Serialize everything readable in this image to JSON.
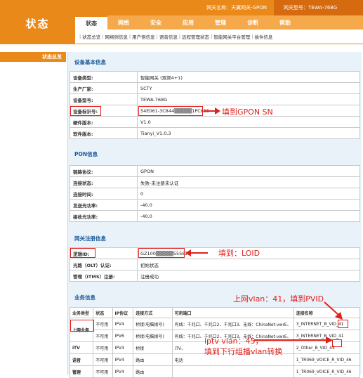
{
  "header": {
    "logo_text": "状态",
    "gateway_name": "网关名称：天翼网关-GPON",
    "gateway_model": "网关型号：TEWA-768G"
  },
  "tabs": [
    {
      "label": "状态",
      "active": true
    },
    {
      "label": "网络",
      "active": false
    },
    {
      "label": "安全",
      "active": false
    },
    {
      "label": "应用",
      "active": false
    },
    {
      "label": "管理",
      "active": false
    },
    {
      "label": "诊断",
      "active": false
    },
    {
      "label": "帮助",
      "active": false
    }
  ],
  "subnav": [
    "状态总览",
    "网络侧信息",
    "用户侧信息",
    "语音信息",
    "远程管理状态",
    "智能网关平台管理",
    "插件信息"
  ],
  "sidebar": {
    "item": "状态总览"
  },
  "device_info": {
    "title": "设备基本信息",
    "rows": [
      {
        "k": "设备类型:",
        "v": "智能网关 (双频4+1)"
      },
      {
        "k": "生产厂家:",
        "v": "SCTY"
      },
      {
        "k": "设备型号:",
        "v": "TEWA-768G"
      },
      {
        "k": "设备标识号:",
        "v": "54E061-3C844▒▒▒▒▒1PC6E5"
      },
      {
        "k": "硬件版本:",
        "v": "V1.0"
      },
      {
        "k": "软件版本:",
        "v": "Tianyi_V1.0.3"
      }
    ]
  },
  "pon_info": {
    "title": "PON信息",
    "rows": [
      {
        "k": "链路协议:",
        "v": "GPON"
      },
      {
        "k": "连接状态:",
        "v": "失败-未注册未认证"
      },
      {
        "k": "连接时间:",
        "v": "0"
      },
      {
        "k": "发送光功率:",
        "v": "-40.0"
      },
      {
        "k": "接收光功率:",
        "v": "-40.0"
      }
    ]
  },
  "reg_info": {
    "title": "网关注册信息",
    "rows": [
      {
        "k": "逻辑ID:",
        "v": "GZ100▒▒▒▒▒555825"
      },
      {
        "k": "光路（OLT）认证:",
        "v": "初始状态"
      },
      {
        "k": "管理（ITMS）注册:",
        "v": "注册成功"
      }
    ]
  },
  "service_info": {
    "title": "业务信息",
    "headers": [
      "业务类型",
      "状态",
      "IP协议",
      "连接方式",
      "可用端口",
      "连接名称"
    ],
    "rows": [
      {
        "type": "上网业务",
        "status": "不可用",
        "ip": "IPV4",
        "mode": "桥接(电脑拨号)",
        "ports": "有线：千兆口、千兆口2、千兆口3、无线：ChinaNet-vwrE、",
        "name": "3_INTERNET_B_VID_41"
      },
      {
        "type": "",
        "status": "不可用",
        "ip": "IPV6",
        "mode": "桥接(电脑拨号)",
        "ports": "有线：千兆口、千兆口2、千兆口3、无线：ChinaNet-vwrE、",
        "name": "3_INTERNET_B_VID_41"
      },
      {
        "type": "iTV",
        "status": "不可用",
        "ip": "IPV4",
        "mode": "桥接",
        "ports": "iTV、",
        "name": "2_Other_B_VID_45"
      },
      {
        "type": "语音",
        "status": "不可用",
        "ip": "IPV4",
        "mode": "路由",
        "ports": "电话",
        "name": "1_TR069_VOICE_R_VID_46"
      },
      {
        "type": "管理",
        "status": "不可用",
        "ip": "IPV4",
        "mode": "路由",
        "ports": "",
        "name": "1_TR069_VOICE_R_VID_46"
      }
    ]
  },
  "annotations": {
    "sn": "填到GPON SN",
    "loid": "填到：LOID",
    "pvid": "上网vlan：41，填到PVID",
    "iptv_line1": "iptv vlan：45，",
    "iptv_line2": "填到下行组播vlan转换"
  },
  "colors": {
    "brand": "#e8891a",
    "tab_bg": "#f6a94a",
    "annotation": "#e0201c",
    "section_title": "#1a5a9a"
  }
}
